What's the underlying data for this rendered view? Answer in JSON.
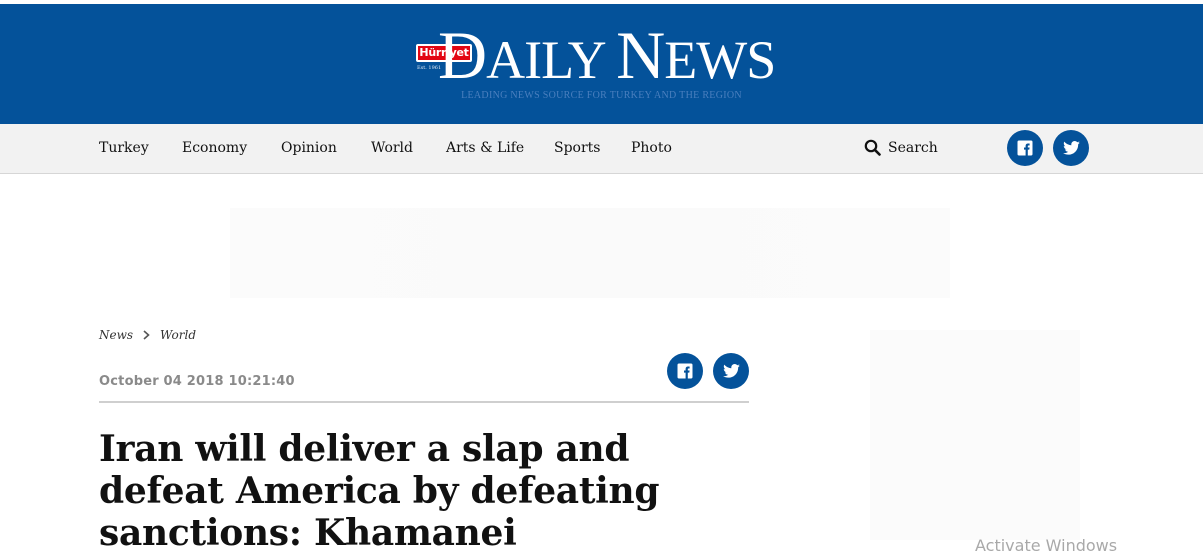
{
  "masthead": {
    "badge": "Hürriyet",
    "est": "Est. 1961",
    "title_big_1": "D",
    "title_small_1": "AILY ",
    "title_big_2": "N",
    "title_small_2": "EWS",
    "tagline": "LEADING NEWS SOURCE FOR TURKEY AND THE REGION"
  },
  "nav": {
    "items": [
      "Turkey",
      "Economy",
      "Opinion",
      "World",
      "Arts & Life",
      "Sports",
      "Photo"
    ],
    "search_label": "Search"
  },
  "breadcrumb": {
    "items": [
      "News",
      "World"
    ]
  },
  "article": {
    "date": "October 04 2018 10:21:40",
    "headline": "Iran will deliver a slap and defeat America by defeating sanctions: Khamanei"
  },
  "overlay": {
    "watermark": "Activate Windows"
  },
  "colors": {
    "brand_blue": "#04529a",
    "badge_red": "#e30613",
    "nav_bg": "#f2f2f2"
  },
  "icons": [
    "search-icon",
    "facebook-icon",
    "twitter-icon",
    "chevron-right-icon"
  ]
}
